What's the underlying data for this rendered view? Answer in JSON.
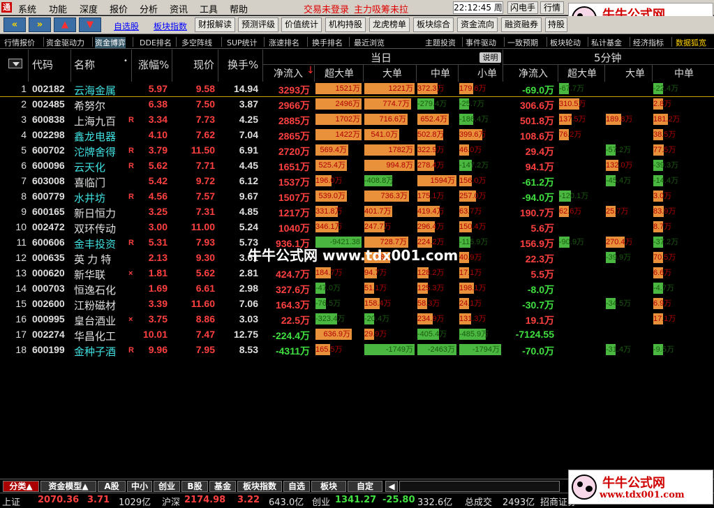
{
  "menubar": {
    "items": [
      "系统",
      "功能",
      "深度",
      "报价",
      "分析",
      "资讯",
      "工具",
      "帮助"
    ],
    "alert1": "交易未登录",
    "alert2": "主力吸筹未拉",
    "clock": "22:12:45 周二",
    "btn_flash": "闪电手",
    "btn_quote": "行情"
  },
  "brand": {
    "name": "牛牛公式网",
    "url": "www.tdx001.com"
  },
  "toolbar": {
    "link1": "自选股",
    "link2": "板块指数",
    "buttons": [
      "财报解读",
      "预测评级",
      "价值统计",
      "机构持股",
      "龙虎榜单",
      "板块综合",
      "资金流向",
      "融资融券",
      "持股"
    ]
  },
  "tabs2": {
    "items": [
      "行情报价",
      "资金驱动力",
      "资金博弈",
      "DDE排名",
      "多空阵线",
      "SUP统计",
      "涨速排名",
      "换手排名",
      "最近浏览",
      "主题投资",
      "事件驱动",
      "一致预期",
      "板块轮动",
      "私计基金",
      "经济指标",
      "数据狐宽"
    ]
  },
  "header": {
    "dang_ri": "当日",
    "five_min": "5分钟",
    "shuoming": "说明",
    "code": "代码",
    "name": "名称",
    "zhangfu": "涨幅%",
    "xianjia": "现价",
    "huanshou": "换手%",
    "jinglr": "净流入",
    "chaoda": "超大单",
    "da": "大单",
    "zhong": "中单",
    "xiao": "小单",
    "jinglr2": "净流入",
    "chaoda2": "超大单",
    "da2": "大单",
    "zhong2": "中单"
  },
  "rows": [
    {
      "idx": "1",
      "code": "002182",
      "name": "云海金属",
      "tag": "",
      "chg": "5.97",
      "price": "9.58",
      "turn": "14.94",
      "net": "3293万",
      "b1": "1521万",
      "b2": "1221万",
      "b3": "372.3万",
      "b4": "179.6万",
      "net5": "-69.0万",
      "c1": "-67.7万",
      "c2": "",
      "c3": "-22.4万"
    },
    {
      "idx": "2",
      "code": "002485",
      "name": "希努尔",
      "tag": "",
      "chg": "6.38",
      "price": "7.50",
      "turn": "3.87",
      "net": "2966万",
      "b1": "2496万",
      "b2": "774.7万",
      "b3": "-279.4万",
      "b4": "-25.7万",
      "net5": "306.6万",
      "c1": "310.5万",
      "c2": "",
      "c3": "2.8万"
    },
    {
      "idx": "3",
      "code": "600838",
      "name": "上海九百",
      "tag": "R",
      "chg": "3.34",
      "price": "7.73",
      "turn": "4.25",
      "net": "2885万",
      "b1": "1702万",
      "b2": "716.6万",
      "b3": "652.4万",
      "b4": "-186.4万",
      "net5": "501.8万",
      "c1": "137.5万",
      "c2": "189.8万",
      "c3": "181.2万"
    },
    {
      "idx": "4",
      "code": "002298",
      "name": "鑫龙电器",
      "tag": "",
      "chg": "4.10",
      "price": "7.62",
      "turn": "7.04",
      "net": "2865万",
      "b1": "1422万",
      "b2": "541.0万",
      "b3": "502.8万",
      "b4": "399.6万",
      "net5": "108.6万",
      "c1": "76.2万",
      "c2": "",
      "c3": "38.5万"
    },
    {
      "idx": "5",
      "code": "600702",
      "name": "沱牌舍得",
      "tag": "R",
      "chg": "3.79",
      "price": "11.50",
      "turn": "6.91",
      "net": "2720万",
      "b1": "569.4万",
      "b2": "1782万",
      "b3": "322.9万",
      "b4": "46.0万",
      "net5": "29.4万",
      "c1": "",
      "c2": "-57.2万",
      "c3": "77.5万"
    },
    {
      "idx": "6",
      "code": "600096",
      "name": "云天化",
      "tag": "R",
      "chg": "5.62",
      "price": "7.71",
      "turn": "4.45",
      "net": "1651万",
      "b1": "525.4万",
      "b2": "994.8万",
      "b3": "278.4万",
      "b4": "-147.2万",
      "net5": "94.1万",
      "c1": "",
      "c2": "132.0万",
      "c3": "-39.3万"
    },
    {
      "idx": "7",
      "code": "603008",
      "name": "喜临门",
      "tag": "",
      "chg": "5.42",
      "price": "9.72",
      "turn": "6.12",
      "net": "1537万",
      "b1": "196.0万",
      "b2": "-408.8万",
      "b3": "1594万",
      "b4": "156.0万",
      "net5": "-61.2万",
      "c1": "",
      "c2": "-45.4万",
      "c3": "-14.4万"
    },
    {
      "idx": "8",
      "code": "600779",
      "name": "水井坊",
      "tag": "R",
      "chg": "4.56",
      "price": "7.57",
      "turn": "9.67",
      "net": "1507万",
      "b1": "539.0万",
      "b2": "736.3万",
      "b3": "175.1万",
      "b4": "257.0万",
      "net5": "-94.0万",
      "c1": "-120.1万",
      "c2": "",
      "c3": "3.0万"
    },
    {
      "idx": "9",
      "code": "600165",
      "name": "新日恒力",
      "tag": "",
      "chg": "3.25",
      "price": "7.31",
      "turn": "4.85",
      "net": "1217万",
      "b1": "331.8万",
      "b2": "401.7万",
      "b3": "419.4万",
      "b4": "63.7万",
      "net5": "190.7万",
      "c1": "62.6万",
      "c2": "25.7万",
      "c3": "83.9万"
    },
    {
      "idx": "10",
      "code": "002472",
      "name": "双环传动",
      "tag": "",
      "chg": "3.00",
      "price": "11.00",
      "turn": "5.24",
      "net": "1040万",
      "b1": "346.1万",
      "b2": "247.7万",
      "b3": "296.4万",
      "b4": "150.4万",
      "net5": "5.6万",
      "c1": "",
      "c2": "",
      "c3": "8.7万"
    },
    {
      "idx": "11",
      "code": "600606",
      "name": "金丰投资",
      "tag": "R",
      "chg": "5.31",
      "price": "7.93",
      "turn": "5.73",
      "net": "936.1万",
      "b1": "-9421.38",
      "b2": "728.7万",
      "b3": "224.2万",
      "b4": "-115.9万",
      "net5": "156.9万",
      "c1": "-90.9万",
      "c2": "270.4万",
      "c3": "-37.2万"
    },
    {
      "idx": "12",
      "code": "000635",
      "name": "英 力 特",
      "tag": "",
      "chg": "2.13",
      "price": "9.30",
      "turn": "3.61",
      "net": "",
      "b1": "",
      "b2": "366",
      "b3": "",
      "b4": "40.9万",
      "net5": "22.3万",
      "c1": "",
      "c2": "-39.9万",
      "c3": "70.5万"
    },
    {
      "idx": "13",
      "code": "000620",
      "name": "新华联",
      "tag": "×",
      "chg": "1.81",
      "price": "5.62",
      "turn": "2.81",
      "net": "424.7万",
      "b1": "184.7万",
      "b2": "94.7万",
      "b3": "128.2万",
      "b4": "17.1万",
      "net5": "5.5万",
      "c1": "",
      "c2": "",
      "c3": "6.6万"
    },
    {
      "idx": "14",
      "code": "000703",
      "name": "恒逸石化",
      "tag": "",
      "chg": "1.69",
      "price": "6.61",
      "turn": "2.98",
      "net": "327.6万",
      "b1": "-47.0万",
      "b2": "51.1万",
      "b3": "125.3万",
      "b4": "198.1万",
      "net5": "-8.0万",
      "c1": "",
      "c2": "",
      "c3": "-4.7万"
    },
    {
      "idx": "15",
      "code": "002600",
      "name": "江粉磁材",
      "tag": "",
      "chg": "3.39",
      "price": "11.60",
      "turn": "7.06",
      "net": "164.3万",
      "b1": "-76.5万",
      "b2": "158.4万",
      "b3": "58.3万",
      "b4": "24.1万",
      "net5": "-30.7万",
      "c1": "",
      "c2": "-34.5万",
      "c3": "6.9万"
    },
    {
      "idx": "16",
      "code": "000995",
      "name": "皇台酒业",
      "tag": "×",
      "chg": "3.75",
      "price": "8.86",
      "turn": "3.03",
      "net": "22.5万",
      "b1": "-323.4万",
      "b2": "-20.4万",
      "b3": "234.9万",
      "b4": "131.3万",
      "net5": "19.1万",
      "c1": "",
      "c2": "",
      "c3": "17.1万"
    },
    {
      "idx": "17",
      "code": "002274",
      "name": "华昌化工",
      "tag": "",
      "chg": "10.01",
      "price": "7.47",
      "turn": "12.75",
      "net": "-224.4万",
      "b1": "636.9万",
      "b2": "29.9万",
      "b3": "-405.4万",
      "b4": "-485.9万",
      "net5": "-7124.55",
      "c1": "",
      "c2": "",
      "c3": ""
    },
    {
      "idx": "18",
      "code": "600199",
      "name": "金种子酒",
      "tag": "R",
      "chg": "9.96",
      "price": "7.95",
      "turn": "8.53",
      "net": "-4311万",
      "b1": "165.5万",
      "b2": "-1749万",
      "b3": "-2463万",
      "b4": "-1794万",
      "net5": "-70.0万",
      "c1": "",
      "c2": "-31.4万",
      "c3": "-9.5万"
    }
  ],
  "watermark": "牛牛公式网 www.tdx001.com",
  "status": {
    "tabs": [
      "分类▲",
      "资金模型▲",
      "A股",
      "中小",
      "创业",
      "B股",
      "基金",
      "板块指数",
      "自选",
      "板块",
      "自定"
    ]
  },
  "ticker": {
    "sh_label": "上证",
    "sh_val": "2070.36",
    "sh_chg": "3.71",
    "sh_amt": "1029亿",
    "hs_label": "沪深",
    "hs_val": "2174.98",
    "hs_chg": "3.22",
    "hs_amt": "643.0亿",
    "cy_label": "创业",
    "cy_val": "1341.27",
    "cy_chg": "-25.80",
    "cy_amt": "332.6亿",
    "total_label": "总成交",
    "total_val": "2493亿",
    "broker": "招商证券"
  }
}
